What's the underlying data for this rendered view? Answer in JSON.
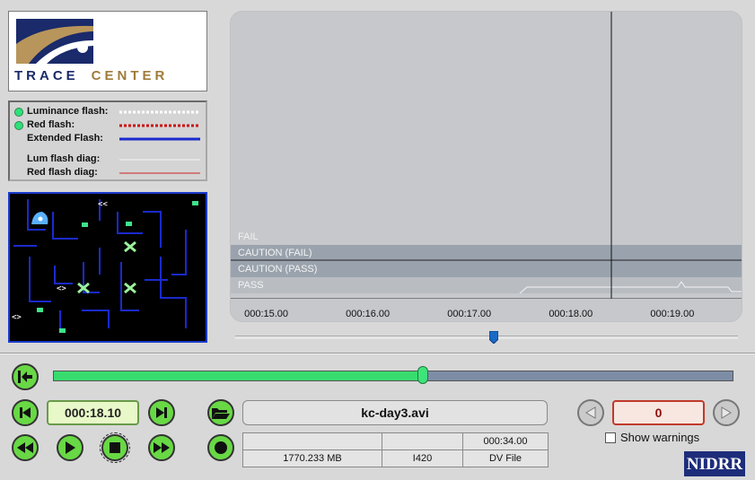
{
  "logo": {
    "word1": "TRACE",
    "word2": "CENTER",
    "colors": {
      "navy": "#1a2a6a",
      "gold": "#a07b3a"
    }
  },
  "legend": {
    "items": [
      {
        "label": "Luminance flash:",
        "indicator": true,
        "line_style": "dotted",
        "line_color": "#ffffff"
      },
      {
        "label": "Red flash:",
        "indicator": true,
        "line_style": "dotted",
        "line_color": "#cc1111"
      },
      {
        "label": "Extended Flash:",
        "indicator": false,
        "line_style": "solid",
        "line_color": "#1a2acc"
      },
      {
        "label": "Lum flash diag:",
        "indicator": false,
        "line_style": "thin",
        "line_color": "#f4f4f4"
      },
      {
        "label": "Red flash diag:",
        "indicator": false,
        "line_style": "thin",
        "line_color": "#cc2222"
      }
    ],
    "indicator_color": "#2ee07a"
  },
  "graph": {
    "bands": [
      "FAIL",
      "CAUTION (FAIL)",
      "CAUTION (PASS)",
      "PASS"
    ],
    "time_ticks": [
      "000:15.00",
      "000:16.00",
      "000:17.00",
      "000:18.00",
      "000:19.00"
    ],
    "tick_values_s": [
      15,
      16,
      17,
      18,
      19
    ],
    "visible_range_s": [
      14.65,
      19.7
    ],
    "cursor_time_s": 18.4,
    "background": "#c6c8cb"
  },
  "scrub": {
    "position": 0.5
  },
  "transport": {
    "current_time": "000:18.10",
    "progress": 0.543,
    "buttons": [
      "go-to-start",
      "step-back",
      "step-forward",
      "rewind",
      "play",
      "stop",
      "fast-forward",
      "record",
      "open-file"
    ]
  },
  "file": {
    "name": "kc-day3.avi",
    "duration": "000:34.00",
    "size": "1770.233 MB",
    "format": "I420",
    "type": "DV File"
  },
  "warnings": {
    "count": "0",
    "show_label": "Show warnings",
    "show_checked": false
  },
  "footer": {
    "sponsor": "NIDRR"
  }
}
